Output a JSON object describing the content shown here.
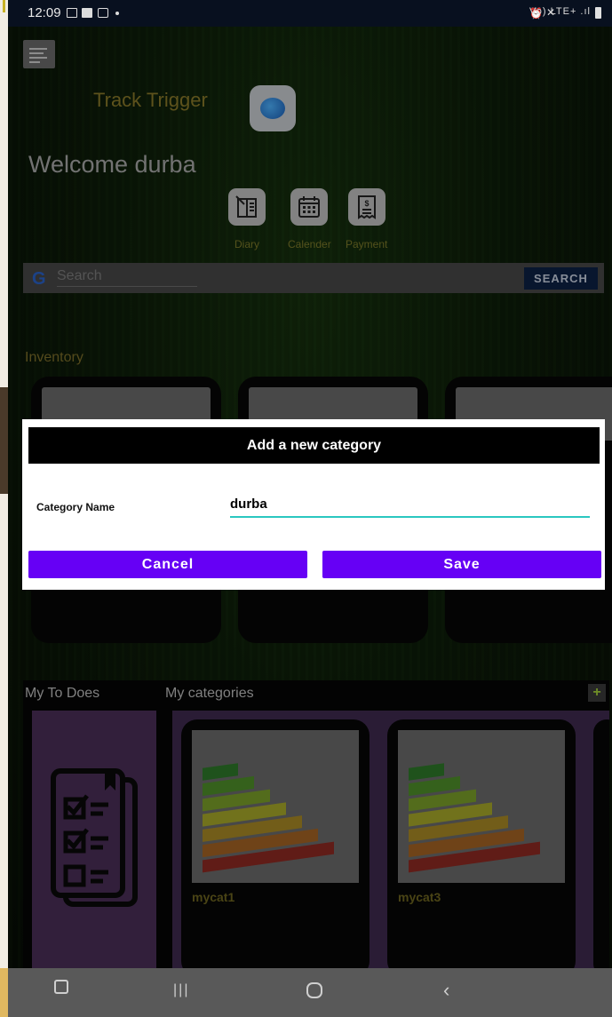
{
  "status": {
    "time": "12:09",
    "right_text": "Vo) LTE+ .ıl"
  },
  "app": {
    "title": "Track Trigger",
    "welcome": "Welcome durba"
  },
  "quick_actions": [
    {
      "label": "Diary",
      "icon": "diary-icon"
    },
    {
      "label": "Calender",
      "icon": "calendar-icon"
    },
    {
      "label": "Payment",
      "icon": "payment-icon"
    }
  ],
  "search": {
    "placeholder": "Search",
    "button_label": "SEARCH"
  },
  "inventory": {
    "label": "Inventory"
  },
  "bottom": {
    "todos_label": "My To Does",
    "categories_label": "My categories",
    "add_label": "+",
    "categories": [
      {
        "name": "mycat1"
      },
      {
        "name": "mycat3"
      }
    ]
  },
  "dialog": {
    "title": "Add a new category",
    "field_label": "Category Name",
    "field_value": "durba",
    "cancel_label": "Cancel",
    "save_label": "Save"
  },
  "colors": {
    "accent": "#6600f5",
    "input_underline": "#2ac7c0",
    "search_button": "#0c2145"
  }
}
